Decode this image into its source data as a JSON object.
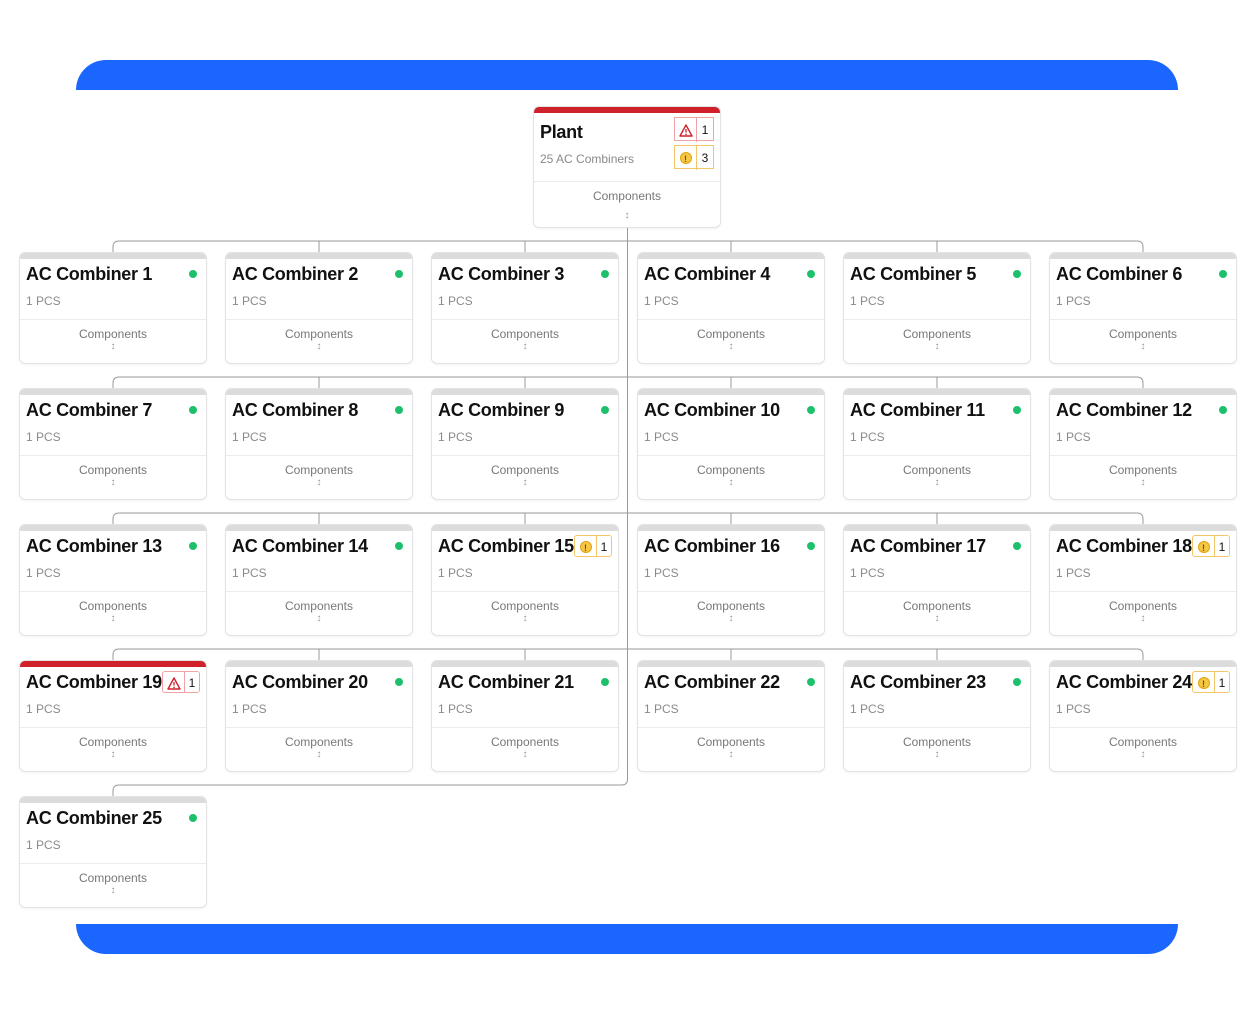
{
  "colors": {
    "band": "#1a66ff",
    "ok": "#1fc06b",
    "warning": "#f6c744",
    "error": "#d0202a",
    "connector": "#9a9a9a"
  },
  "plant": {
    "title": "Plant",
    "subtitle": "25 AC Combiners",
    "components_label": "Components",
    "error_count": "1",
    "warning_count": "3",
    "status": "error"
  },
  "combiners": [
    {
      "name": "AC Combiner 1",
      "qty": "1 PCS",
      "components_label": "Components",
      "status": "ok"
    },
    {
      "name": "AC Combiner 2",
      "qty": "1 PCS",
      "components_label": "Components",
      "status": "ok"
    },
    {
      "name": "AC Combiner 3",
      "qty": "1 PCS",
      "components_label": "Components",
      "status": "ok"
    },
    {
      "name": "AC Combiner 4",
      "qty": "1 PCS",
      "components_label": "Components",
      "status": "ok"
    },
    {
      "name": "AC Combiner 5",
      "qty": "1 PCS",
      "components_label": "Components",
      "status": "ok"
    },
    {
      "name": "AC Combiner 6",
      "qty": "1 PCS",
      "components_label": "Components",
      "status": "ok"
    },
    {
      "name": "AC Combiner 7",
      "qty": "1 PCS",
      "components_label": "Components",
      "status": "ok"
    },
    {
      "name": "AC Combiner 8",
      "qty": "1 PCS",
      "components_label": "Components",
      "status": "ok"
    },
    {
      "name": "AC Combiner 9",
      "qty": "1 PCS",
      "components_label": "Components",
      "status": "ok"
    },
    {
      "name": "AC Combiner 10",
      "qty": "1 PCS",
      "components_label": "Components",
      "status": "ok"
    },
    {
      "name": "AC Combiner 11",
      "qty": "1 PCS",
      "components_label": "Components",
      "status": "ok"
    },
    {
      "name": "AC Combiner 12",
      "qty": "1 PCS",
      "components_label": "Components",
      "status": "ok"
    },
    {
      "name": "AC Combiner 13",
      "qty": "1 PCS",
      "components_label": "Components",
      "status": "ok"
    },
    {
      "name": "AC Combiner 14",
      "qty": "1 PCS",
      "components_label": "Components",
      "status": "ok"
    },
    {
      "name": "AC Combiner 15",
      "qty": "1 PCS",
      "components_label": "Components",
      "status": "warning",
      "count": "1"
    },
    {
      "name": "AC Combiner 16",
      "qty": "1 PCS",
      "components_label": "Components",
      "status": "ok"
    },
    {
      "name": "AC Combiner 17",
      "qty": "1 PCS",
      "components_label": "Components",
      "status": "ok"
    },
    {
      "name": "AC Combiner 18",
      "qty": "1 PCS",
      "components_label": "Components",
      "status": "warning",
      "count": "1"
    },
    {
      "name": "AC Combiner 19",
      "qty": "1 PCS",
      "components_label": "Components",
      "status": "error",
      "count": "1"
    },
    {
      "name": "AC Combiner 20",
      "qty": "1 PCS",
      "components_label": "Components",
      "status": "ok"
    },
    {
      "name": "AC Combiner 21",
      "qty": "1 PCS",
      "components_label": "Components",
      "status": "ok"
    },
    {
      "name": "AC Combiner 22",
      "qty": "1 PCS",
      "components_label": "Components",
      "status": "ok"
    },
    {
      "name": "AC Combiner 23",
      "qty": "1 PCS",
      "components_label": "Components",
      "status": "ok"
    },
    {
      "name": "AC Combiner 24",
      "qty": "1 PCS",
      "components_label": "Components",
      "status": "warning",
      "count": "1"
    },
    {
      "name": "AC Combiner 25",
      "qty": "1 PCS",
      "components_label": "Components",
      "status": "ok"
    }
  ]
}
